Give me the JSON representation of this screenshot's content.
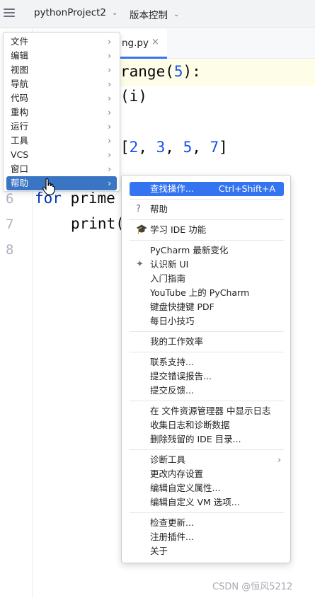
{
  "titlebar": {
    "project": "pythonProject2",
    "vcs": "版本控制"
  },
  "tab": {
    "label": "ng.py",
    "close": "×"
  },
  "code": {
    "line1_fn": "range",
    "line1_open": "(",
    "line1_arg": "5",
    "line1_close": "):",
    "line2": "(i)",
    "line4_open": "[",
    "line4_nums": [
      "2",
      "3",
      "5",
      "7"
    ],
    "line4_close": "]",
    "line6_kw": "for",
    "line6_rest": " prime",
    "line7": "print(",
    "line_numbers": [
      "6",
      "7",
      "8"
    ]
  },
  "main_menu": {
    "items": [
      {
        "label": "文件"
      },
      {
        "label": "编辑"
      },
      {
        "label": "视图"
      },
      {
        "label": "导航"
      },
      {
        "label": "代码"
      },
      {
        "label": "重构"
      },
      {
        "label": "运行"
      },
      {
        "label": "工具"
      },
      {
        "label": "VCS"
      },
      {
        "label": "窗口"
      },
      {
        "label": "帮助"
      }
    ],
    "active_index": 10
  },
  "help_menu": {
    "find_action": "查找操作...",
    "find_action_shortcut": "Ctrl+Shift+A",
    "help": "帮助",
    "learn_ide": "学习 IDE 功能",
    "whats_new": "PyCharm 最新变化",
    "new_ui": "认识新 UI",
    "getting_started": "入门指南",
    "youtube": "YouTube 上的 PyCharm",
    "keymap_pdf": "键盘快捷键 PDF",
    "tip_of_day": "每日小技巧",
    "productivity": "我的工作效率",
    "contact_support": "联系支持...",
    "submit_bug": "提交错误报告...",
    "submit_feedback": "提交反馈...",
    "show_log": "在 文件资源管理器 中显示日志",
    "collect_logs": "收集日志和诊断数据",
    "delete_leftover": "删除残留的 IDE 目录...",
    "diagnostic_tools": "诊断工具",
    "change_memory": "更改内存设置",
    "edit_properties": "编辑自定义属性...",
    "edit_vm": "编辑自定义 VM 选项...",
    "check_updates": "检查更新...",
    "register_plugins": "注册插件...",
    "about": "关于"
  },
  "watermark": "CSDN @恒风5212"
}
